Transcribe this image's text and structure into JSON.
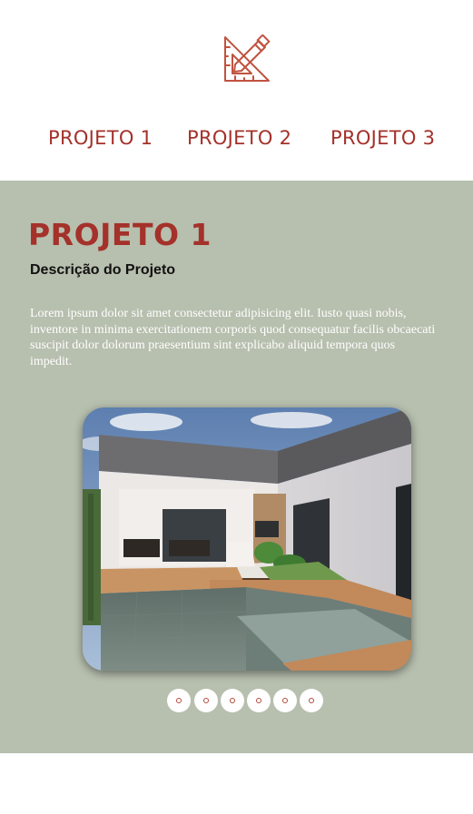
{
  "header": {
    "logo_icon": "triangle-ruler-pencil-icon",
    "nav": [
      {
        "label": "PROJETO 1"
      },
      {
        "label": "PROJETO 2"
      },
      {
        "label": "PROJETO 3"
      }
    ]
  },
  "project": {
    "title": "PROJETO 1",
    "subtitle": "Descrição do Projeto",
    "description": "Lorem ipsum dolor sit amet consectetur adipisicing elit. Iusto quasi nobis, inventore in minima exercitationem corporis quod consequatur facilis obcaecati suscipit dolor dolorum praesentium sint explicabo aliquid tempora quos impedit.",
    "image": "render-house-pool-deck"
  },
  "carousel": {
    "slide_count": 6,
    "active_index": 0
  },
  "colors": {
    "accent": "#a4312a",
    "section_bg": "#b7bfae",
    "text_light": "#ffffff"
  }
}
